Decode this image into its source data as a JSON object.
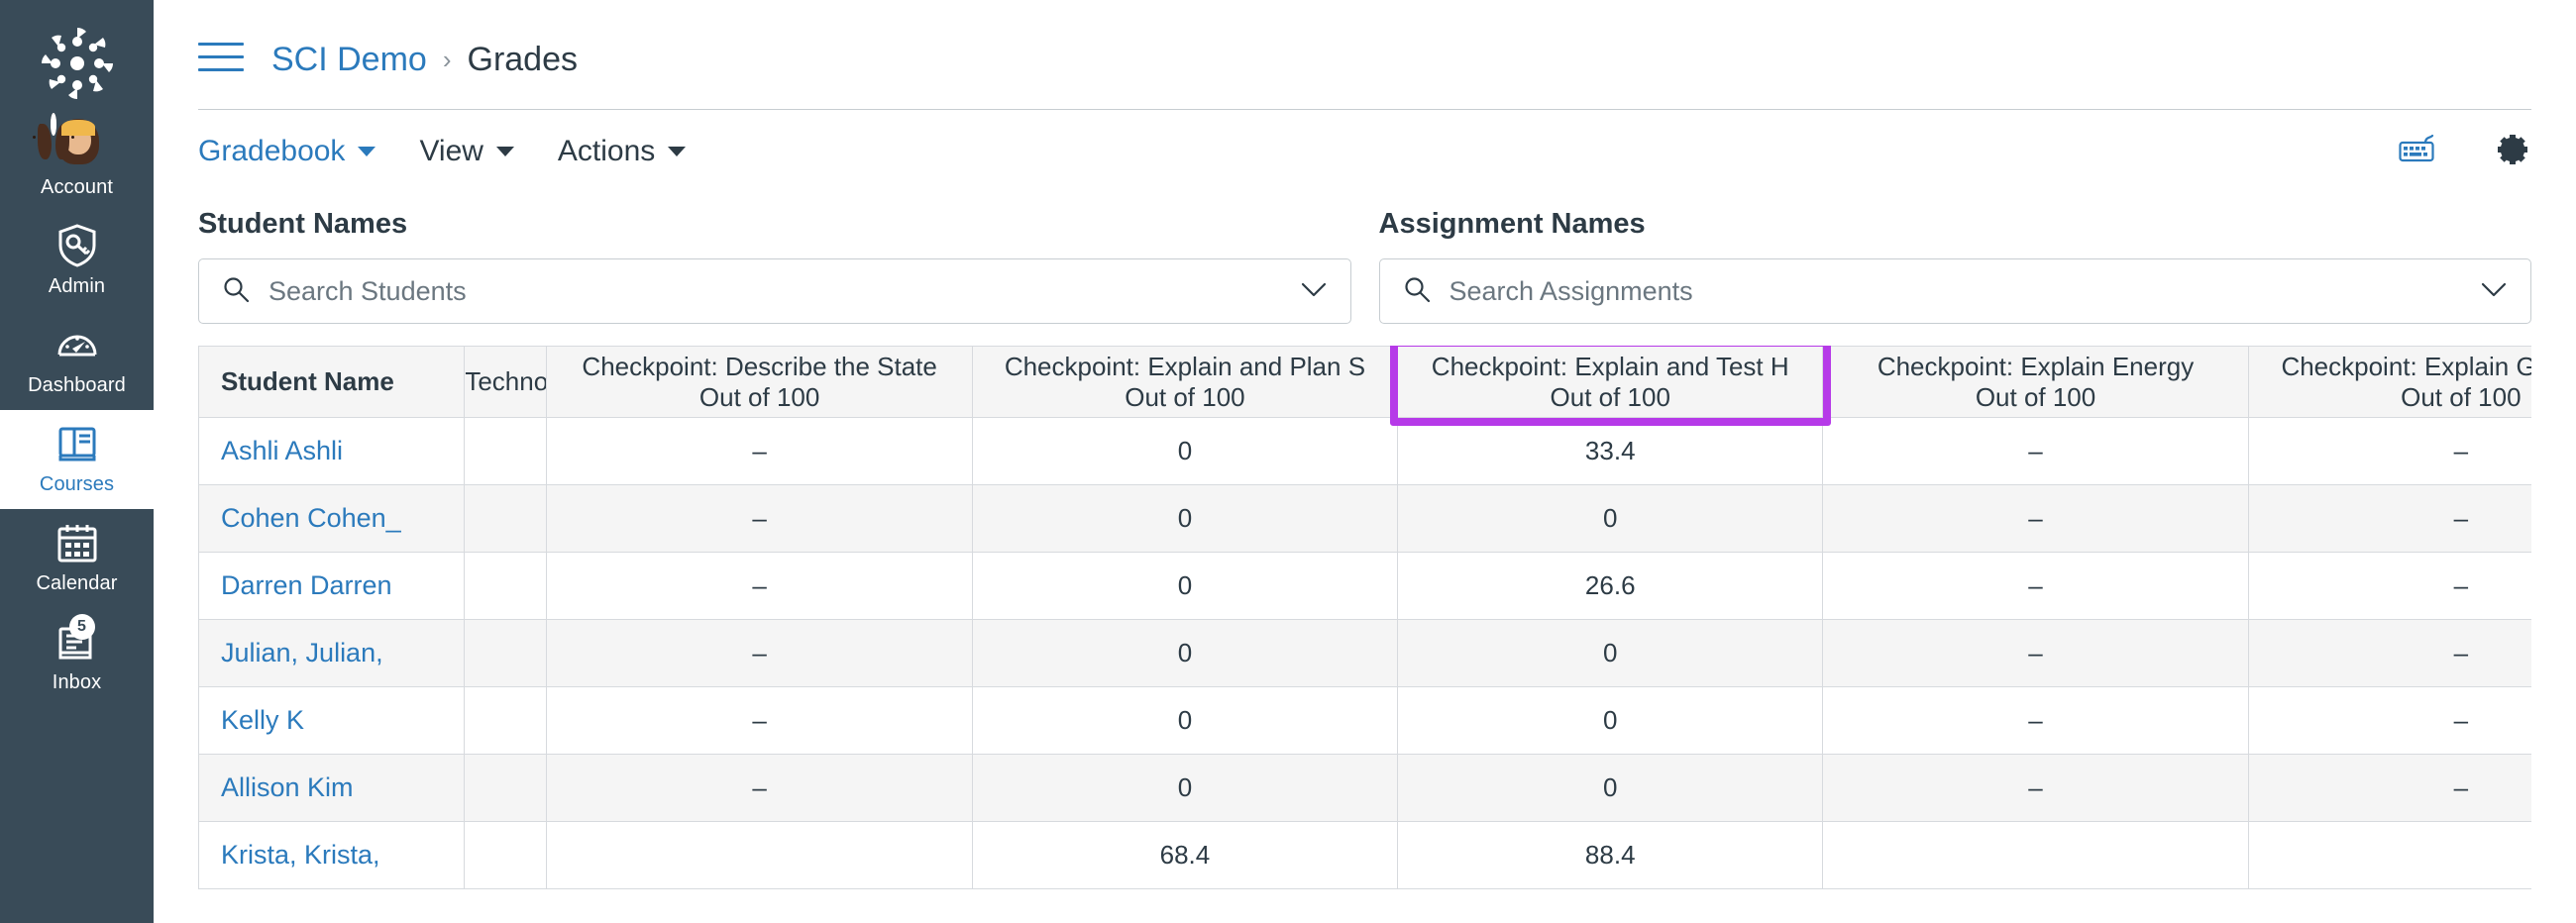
{
  "sidebar": {
    "logo_icon": "canvas-logo-icon",
    "items": [
      {
        "label": "Account",
        "icon": "avatar-icon",
        "active": false
      },
      {
        "label": "Admin",
        "icon": "shield-key-icon",
        "active": false
      },
      {
        "label": "Dashboard",
        "icon": "speedometer-icon",
        "active": false
      },
      {
        "label": "Courses",
        "icon": "book-icon",
        "active": true
      },
      {
        "label": "Calendar",
        "icon": "calendar-icon",
        "active": false
      },
      {
        "label": "Inbox",
        "icon": "inbox-icon",
        "active": false,
        "badge": "5"
      }
    ]
  },
  "header": {
    "menu_icon": "hamburger-icon",
    "breadcrumb": {
      "course": "SCI Demo",
      "separator": "›",
      "current": "Grades"
    }
  },
  "toolbar": {
    "gradebook_label": "Gradebook",
    "view_label": "View",
    "actions_label": "Actions",
    "keyboard_icon": "keyboard-shortcuts-icon",
    "settings_icon": "gear-icon"
  },
  "filters": {
    "students": {
      "label": "Student Names",
      "placeholder": "Search Students",
      "value": "",
      "search_icon": "search-icon",
      "chevron_icon": "chevron-down-icon"
    },
    "assignments": {
      "label": "Assignment Names",
      "placeholder": "Search Assignments",
      "value": "",
      "search_icon": "search-icon",
      "chevron_icon": "chevron-down-icon"
    }
  },
  "highlight": {
    "color": "#B63AE8",
    "target_column": "Checkpoint: Explain and Test H"
  },
  "gradebook": {
    "columns": [
      {
        "key": "name",
        "title": "Student Name",
        "subtitle": "",
        "type": "name"
      },
      {
        "key": "tech",
        "title": "Technolo",
        "subtitle": "",
        "type": "narrow"
      },
      {
        "key": "a1",
        "title": "Checkpoint: Describe the State",
        "subtitle": "Out of 100",
        "type": "assignment"
      },
      {
        "key": "a2",
        "title": "Checkpoint: Explain and Plan S",
        "subtitle": "Out of 100",
        "type": "assignment"
      },
      {
        "key": "a3",
        "title": "Checkpoint: Explain and Test H",
        "subtitle": "Out of 100",
        "type": "assignment",
        "highlighted": true
      },
      {
        "key": "a4",
        "title": "Checkpoint: Explain Energy",
        "subtitle": "Out of 100",
        "type": "assignment"
      },
      {
        "key": "a5",
        "title": "Checkpoint: Explain Gravitation",
        "subtitle": "Out of 100",
        "type": "assignment"
      },
      {
        "key": "a6",
        "title": "",
        "subtitle": "",
        "type": "tail"
      }
    ],
    "rows": [
      {
        "name": "Ashli Ashli",
        "tech": "",
        "a1": "–",
        "a2": "0",
        "a3": "33.4",
        "a4": "–",
        "a5": "–",
        "a6": ""
      },
      {
        "name": "Cohen Cohen_",
        "tech": "",
        "a1": "–",
        "a2": "0",
        "a3": "0",
        "a4": "–",
        "a5": "–",
        "a6": ""
      },
      {
        "name": "Darren Darren",
        "tech": "",
        "a1": "–",
        "a2": "0",
        "a3": "26.6",
        "a4": "–",
        "a5": "–",
        "a6": ""
      },
      {
        "name": "Julian, Julian,",
        "tech": "",
        "a1": "–",
        "a2": "0",
        "a3": "0",
        "a4": "–",
        "a5": "–",
        "a6": ""
      },
      {
        "name": "Kelly K",
        "tech": "",
        "a1": "–",
        "a2": "0",
        "a3": "0",
        "a4": "–",
        "a5": "–",
        "a6": ""
      },
      {
        "name": "Allison Kim",
        "tech": "",
        "a1": "–",
        "a2": "0",
        "a3": "0",
        "a4": "–",
        "a5": "–",
        "a6": ""
      },
      {
        "name": "Krista, Krista,",
        "tech": "",
        "a1": "",
        "a2": "68.4",
        "a3": "88.4",
        "a4": "",
        "a5": "",
        "a6": ""
      }
    ]
  }
}
